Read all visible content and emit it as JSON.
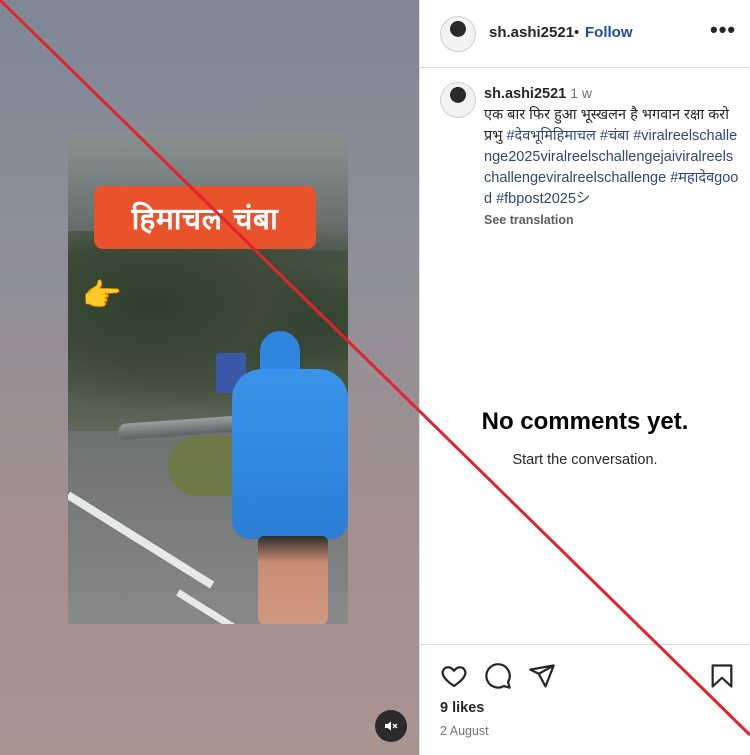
{
  "media": {
    "banner_text": "हिमाचल चंबा",
    "pointer_glyph": "👉",
    "mute_icon": "speaker-muted-icon"
  },
  "post_header": {
    "username": "sh.ashi2521",
    "separator": "•",
    "follow_label": "Follow",
    "more_label": "•••"
  },
  "caption": {
    "username": "sh.ashi2521",
    "time_ago": "1 w",
    "text": "एक बार फिर हुआ भूस्खलन है भगवान रक्षा करो प्रभु",
    "hashtags": "#देवभूमिहिमाचल #चंबा #viralreelschallenge2025viralreelschallengejaiviralreelschallengeviralreelschallenge #महादेवgood #fbpost2025シ",
    "see_translation": "See translation"
  },
  "comments": {
    "empty_title": "No comments yet.",
    "empty_subtitle": "Start the conversation."
  },
  "actions": {
    "like_icon": "heart-icon",
    "comment_icon": "comment-icon",
    "share_icon": "paper-plane-icon",
    "save_icon": "bookmark-icon",
    "likes": "9 likes",
    "date": "2 August"
  },
  "colors": {
    "follow_link": "#1f4aa0",
    "hashtag": "#33467a",
    "banner_bg": "#e9532c",
    "raincoat": "#2f86e0",
    "strike_line": "#e0242f"
  }
}
